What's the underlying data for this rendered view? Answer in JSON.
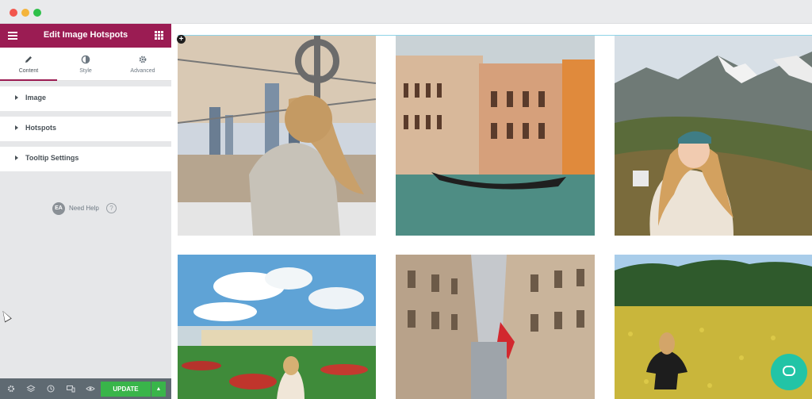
{
  "window": {
    "buttons": [
      "close",
      "minimize",
      "zoom"
    ]
  },
  "panel": {
    "title": "Edit Image Hotspots",
    "menu_icon": "hamburger-icon",
    "grid_icon": "apps-grid-icon",
    "tabs": [
      {
        "label": "Content",
        "icon": "pencil-icon",
        "active": true
      },
      {
        "label": "Style",
        "icon": "half-circle-icon",
        "active": false
      },
      {
        "label": "Advanced",
        "icon": "gear-icon",
        "active": false
      }
    ],
    "sections": [
      {
        "label": "Image"
      },
      {
        "label": "Hotspots"
      },
      {
        "label": "Tooltip Settings"
      }
    ],
    "help": {
      "badge": "EA",
      "label": "Need Help",
      "icon": "?"
    },
    "footer": {
      "icons": [
        "settings-icon",
        "layers-icon",
        "history-icon",
        "responsive-icon",
        "preview-eye-icon"
      ],
      "update_label": "UPDATE",
      "dropdown_icon": "▲"
    },
    "accent_color": "#9b1c53",
    "update_color": "#39b54a"
  },
  "gallery": {
    "photos": [
      {
        "subject": "woman-on-observation-deck-city-skyline"
      },
      {
        "subject": "venice-canal-gondola"
      },
      {
        "subject": "woman-in-mountain-landscape"
      },
      {
        "subject": "woman-in-palace-garden"
      },
      {
        "subject": "narrow-city-street-with-flag"
      },
      {
        "subject": "woman-in-yellow-flower-field"
      }
    ]
  },
  "chat_widget": {
    "icon": "chat-bubble-icon",
    "color": "#22c4a6"
  }
}
